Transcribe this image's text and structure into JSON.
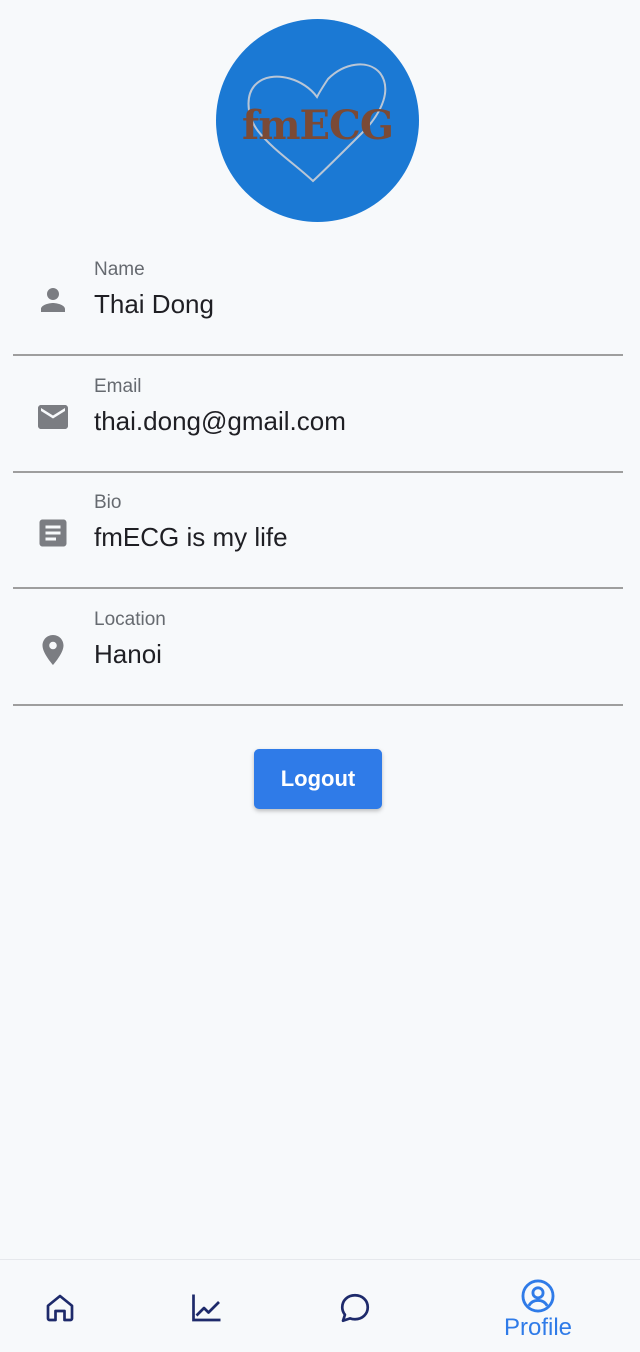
{
  "header": {
    "logo_text": "fmECG",
    "brand_color": "#1b79d4"
  },
  "profile": {
    "fields": [
      {
        "icon": "person-icon",
        "label": "Name",
        "value": "Thai Dong"
      },
      {
        "icon": "mail-icon",
        "label": "Email",
        "value": "thai.dong@gmail.com"
      },
      {
        "icon": "article-icon",
        "label": "Bio",
        "value": "fmECG is my life"
      },
      {
        "icon": "location-pin-icon",
        "label": "Location",
        "value": "Hanoi"
      }
    ],
    "logout_label": "Logout"
  },
  "bottom_nav": {
    "items": [
      {
        "icon": "home-icon",
        "label": "",
        "active": false
      },
      {
        "icon": "chart-icon",
        "label": "",
        "active": false
      },
      {
        "icon": "chat-icon",
        "label": "",
        "active": false
      },
      {
        "icon": "profile-icon",
        "label": "Profile",
        "active": true
      }
    ],
    "active_color": "#2f7be8",
    "inactive_color": "#1e2a6b"
  }
}
